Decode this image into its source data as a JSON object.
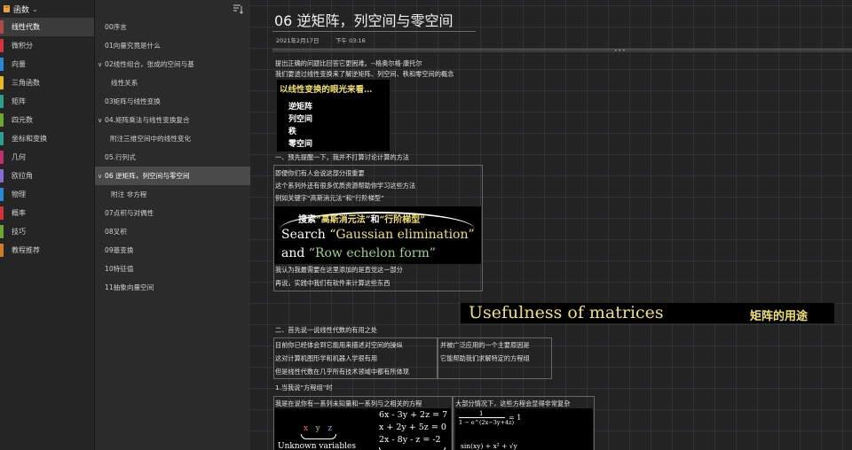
{
  "notebook": {
    "name": "函数",
    "icon_color": "#f0a040"
  },
  "sections": [
    {
      "label": "线性代数",
      "color": "#b04a4a",
      "active": true
    },
    {
      "label": "微积分",
      "color": "#d6323c"
    },
    {
      "label": "向量",
      "color": "#2a88d8"
    },
    {
      "label": "三角函数",
      "color": "#e8b820"
    },
    {
      "label": "矩阵",
      "color": "#2e9e8e"
    },
    {
      "label": "四元数",
      "color": "#6ba832"
    },
    {
      "label": "坐标和变换",
      "color": "#2e9e8e"
    },
    {
      "label": "几何",
      "color": "#c0306a"
    },
    {
      "label": "欧拉角",
      "color": "#8a6ad6"
    },
    {
      "label": "物理",
      "color": "#2a88d8"
    },
    {
      "label": "概率",
      "color": "#d6323c"
    },
    {
      "label": "技巧",
      "color": "#6ba832"
    },
    {
      "label": "教程推荐",
      "color": "#d07a2a"
    }
  ],
  "pages": [
    {
      "label": "00序言",
      "level": "top"
    },
    {
      "label": "01向量究竟是什么",
      "level": "top"
    },
    {
      "label": "02线性组合，张成的空间与基",
      "level": "top",
      "caret": "∨"
    },
    {
      "label": "线性关系",
      "level": "sub"
    },
    {
      "label": "03矩阵与线性变换",
      "level": "top"
    },
    {
      "label": "04.矩阵乘法与线性变换复合",
      "level": "top",
      "caret": "∨"
    },
    {
      "label": "附注三维空间中的线性变化",
      "level": "sub2"
    },
    {
      "label": "05.行列式",
      "level": "top"
    },
    {
      "label": "06 逆矩阵，列空间与零空间",
      "level": "top",
      "caret": "∨",
      "active": true
    },
    {
      "label": "附注 非方程",
      "level": "sub"
    },
    {
      "label": "07点积与对偶性",
      "level": "top"
    },
    {
      "label": "08叉积",
      "level": "top"
    },
    {
      "label": "09基变换",
      "level": "top"
    },
    {
      "label": "10特征值",
      "level": "top"
    },
    {
      "label": "11抽象向量空间",
      "level": "top"
    }
  ],
  "page": {
    "title": "06 逆矩阵，列空间与零空间",
    "date": "2021年2月17日",
    "time": "下午 03:16",
    "intro_1": "提出正确的问题比回答它更困难。--格奥尔格·康托尔",
    "intro_2": "我们要透过线性变换来了解逆矩阵、列空间、秩和零空间的概念",
    "img_transform": {
      "header": "以线性变换的眼光来看…",
      "items": [
        "逆矩阵",
        "列空间",
        "秩",
        "零空间"
      ]
    },
    "note_1": "一、预先提醒一下，我并不打算讨论计算的方法",
    "box1": [
      "即便你们有人会说这部分很重要",
      "这个系列外还有很多优质资源帮助你学习这些方法",
      "例如关键字“高斯消元法”和“行阶梯型”"
    ],
    "img_gauss": {
      "line1_a": "搜索",
      "line1_b": "“高斯消元法”",
      "line1_c": "和",
      "line1_d": "“行阶梯型”",
      "line2_a": "Search",
      "line2_b": "“Gaussian elimination”",
      "line3_a": "and",
      "line3_b": "“Row echelon form”"
    },
    "box1_after": [
      "我认为我最需要在这里添加的是直觉这一部分",
      "再说，实践中我们有软件来计算这些东西"
    ],
    "useful_en": "Usefulness of matrices",
    "useful_zh": "矩阵的用途",
    "note_2": "二、首先说一说线性代数的有用之处",
    "box2_left": [
      "目前你已经体会到它能用来描述对空间的操纵",
      "这对计算机图形学和机器人学很有用",
      "但是线性代数在几乎所有技术领域中都有所体现"
    ],
    "box2_right": [
      "并被广泛应用的一个主要原因是",
      "它能帮助我们求解特定的方程组"
    ],
    "note_3": "1.当我说“方程组”时",
    "box3_left": "我是在说你有一系列未知量和一系列与之相关的方程",
    "box3_right": "大部分情况下，这些方程会显得非常复杂",
    "img_eq": {
      "eq1": "6x - 3y + 2z = 7",
      "eq2": "x + 2y + 5z = 0",
      "eq3": "2x - 8y - z = -2",
      "var_x": "x",
      "var_y": "y",
      "var_z": "z",
      "unknown": "Unknown variables"
    },
    "img_complex": {
      "numer": "1",
      "denom": "1 − e^(2x−3y+4z)",
      "rhs": "= 1",
      "formula2": "sin(xy) + x² + √y"
    }
  }
}
